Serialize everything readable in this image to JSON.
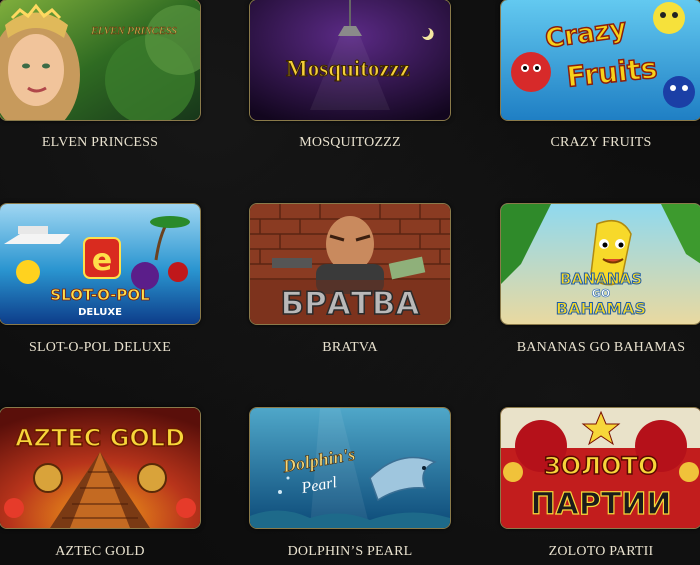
{
  "games": [
    {
      "title": "ELVEN PRINCESS",
      "logo_text": "ELVEN PRINCESS"
    },
    {
      "title": "MOSQUITOZZZ",
      "logo_text": "Mosquitozzz"
    },
    {
      "title": "CRAZY FRUITS",
      "logo_text_1": "Crazy",
      "logo_text_2": "Fruits"
    },
    {
      "title": "SLOT-O-POL DELUXE",
      "logo_text_1": "SLOT-O-POL",
      "logo_text_2": "DELUXE"
    },
    {
      "title": "BRATVA",
      "logo_text": "БРАТВА"
    },
    {
      "title": "BANANAS GO BAHAMAS",
      "logo_text_1": "BANANAS",
      "logo_text_2": "GO",
      "logo_text_3": "BAHAMAS"
    },
    {
      "title": "AZTEC GOLD",
      "logo_text": "AZTEC GOLD"
    },
    {
      "title": "DOLPHIN’S PEARL",
      "logo_text_1": "Dolphin's",
      "logo_text_2": "Pearl"
    },
    {
      "title": "ZOLOTO PARTII",
      "logo_text_1": "ЗОЛОТО",
      "logo_text_2": "ПАРТИИ"
    }
  ]
}
